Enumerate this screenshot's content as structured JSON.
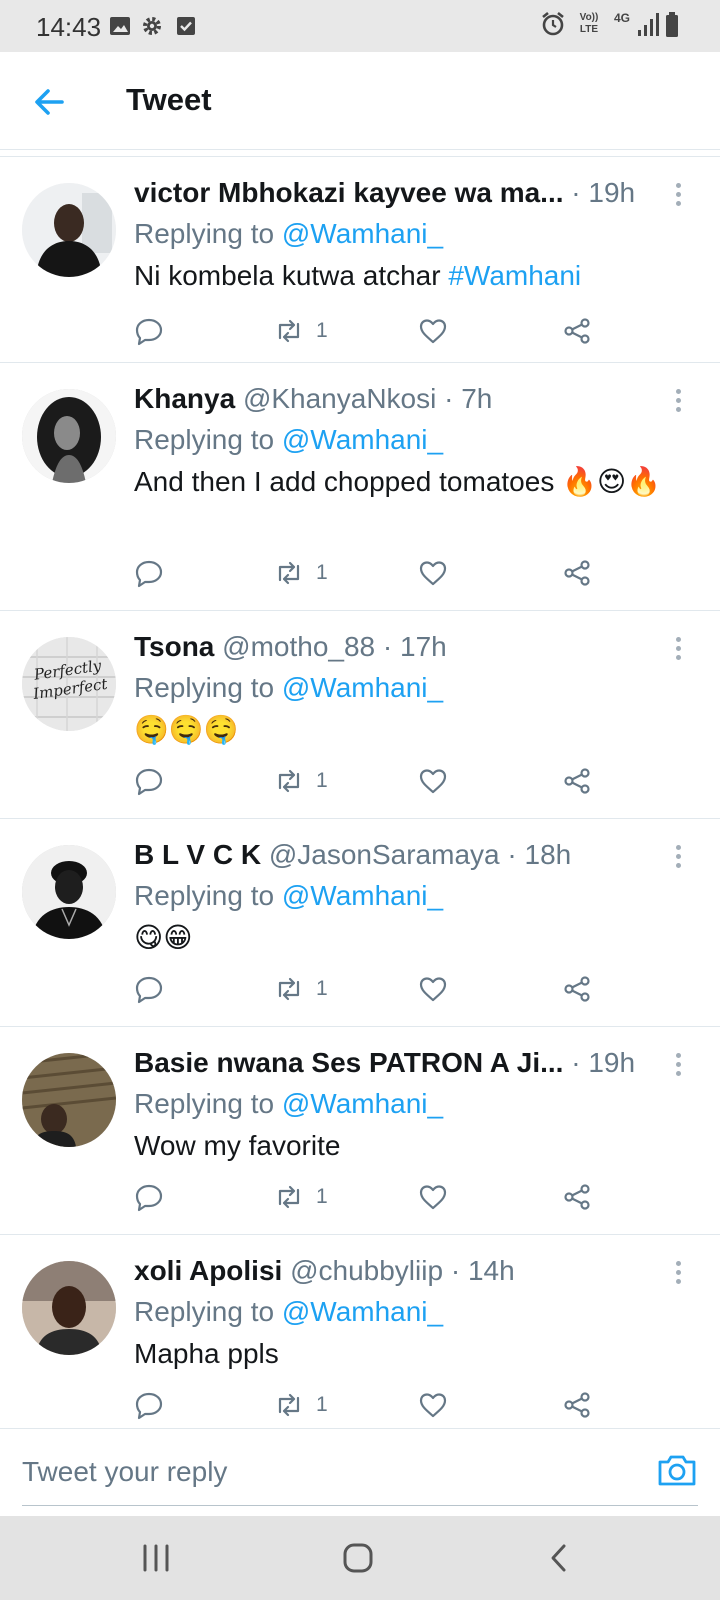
{
  "status_bar": {
    "time": "14:43",
    "left_icons": [
      "image-icon",
      "gear-icon",
      "checkbox-icon"
    ],
    "right_icons": [
      "alarm-icon",
      "volte-icon",
      "4g-icon",
      "signal-icon",
      "battery-icon"
    ],
    "volte_label": "Vo)) LTE",
    "network_label": "4G"
  },
  "header": {
    "title": "Tweet"
  },
  "colors": {
    "accent": "#1da1f2",
    "text_primary": "#14171a",
    "text_secondary": "#657786",
    "divider": "#e1e8ed"
  },
  "tweets": [
    {
      "name": "victor Mbhokazi kayvee wa ma...",
      "handle": "",
      "dot": "·",
      "age": "19h",
      "replying_prefix": "Replying to ",
      "replying_to": "@Wamhani_",
      "text": "Ni kombela kutwa atchar ",
      "hashtag": "#Wamhani",
      "retweets": "1"
    },
    {
      "name": "Khanya",
      "handle": "@KhanyaNkosi",
      "dot": "·",
      "age": "7h",
      "replying_prefix": "Replying to ",
      "replying_to": "@Wamhani_",
      "text": "And then I add chopped tomatoes 🔥😍🔥",
      "hashtag": "",
      "retweets": "1"
    },
    {
      "name": "Tsona",
      "handle": "@motho_88",
      "dot": "·",
      "age": "17h",
      "replying_prefix": "Replying to ",
      "replying_to": "@Wamhani_",
      "text": "🤤🤤🤤",
      "hashtag": "",
      "retweets": "1"
    },
    {
      "name": "B L V C K",
      "handle": "@JasonSaramaya",
      "dot": "·",
      "age": "18h",
      "replying_prefix": "Replying to ",
      "replying_to": "@Wamhani_",
      "text": "😋😁",
      "hashtag": "",
      "retweets": "1"
    },
    {
      "name": "Basie nwana Ses PATRON A Ji...",
      "handle": "",
      "dot": "·",
      "age": "19h",
      "replying_prefix": "Replying to ",
      "replying_to": "@Wamhani_",
      "text": "Wow my favorite",
      "hashtag": "",
      "retweets": "1"
    },
    {
      "name": "xoli Apolisi",
      "handle": "@chubbyliip",
      "dot": "·",
      "age": "14h",
      "replying_prefix": "Replying to ",
      "replying_to": "@Wamhani_",
      "text": "Mapha ppls",
      "hashtag": "",
      "retweets": "1"
    }
  ],
  "tsona_avatar_text": "Perfectly Imperfect",
  "composer": {
    "placeholder": "Tweet your reply"
  },
  "nav_bar": {
    "buttons": [
      "recents-icon",
      "home-icon",
      "back-icon"
    ]
  }
}
